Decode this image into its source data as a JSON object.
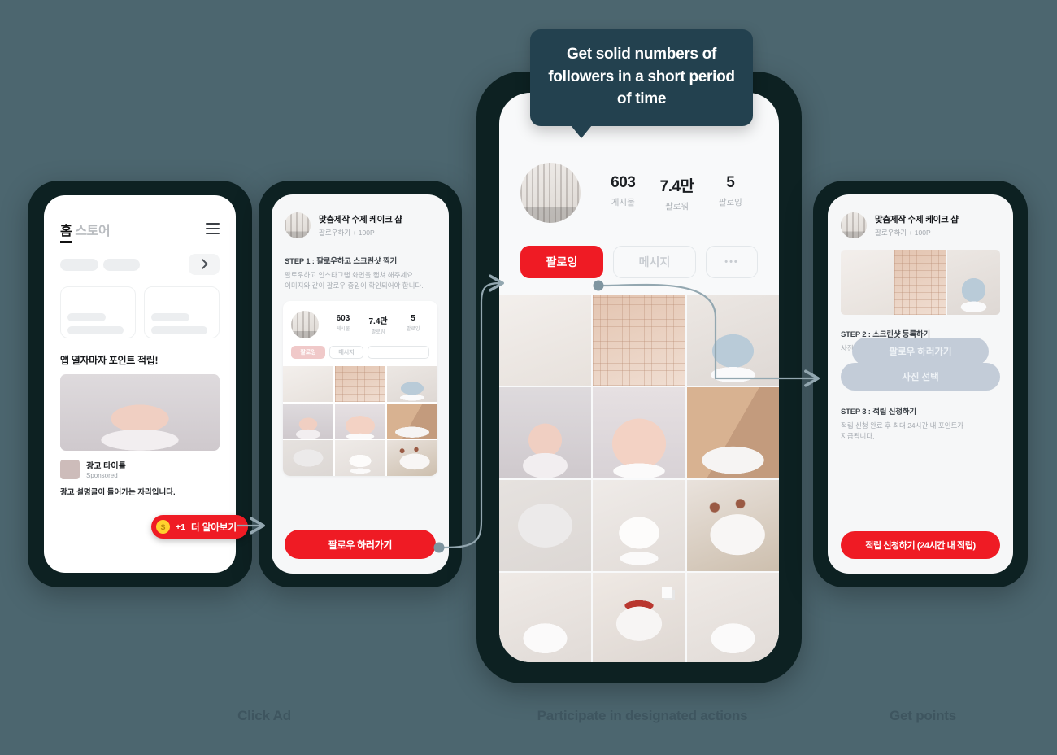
{
  "background_color": "#4c666f",
  "frame_color": "#0d2122",
  "accent_red": "#ef1b24",
  "tooltip": {
    "text": "Get solid numbers of followers in a short period of time",
    "bg": "#23414f"
  },
  "phone1": {
    "tab_active": "홈",
    "tab_inactive": "스토어",
    "menu_icon": "hamburger-icon",
    "ad_heading": "앱 열자마자 포인트 적립!",
    "ad_title": "광고 타이틀",
    "ad_sponsored": "Sponsored",
    "ad_description": "광고 설명글이 들어가는 자리입니다.",
    "cta": {
      "coin": "S",
      "points": "+1",
      "label": "더 알아보기"
    }
  },
  "phone2": {
    "shop_name": "맞춤제작 수제 케이크 샵",
    "shop_sub": "팔로우하기 + 100P",
    "step_title": "STEP 1 : 팔로우하고 스크린샷 찍기",
    "step_desc_1": "팔로우하고  인스타그램 화면을 캡쳐 해주세요.",
    "step_desc_2": "이미지와 같이 팔로우 중임이 확인되어야 합니다.",
    "mock": {
      "stats": [
        {
          "value": "603",
          "label": "게시물"
        },
        {
          "value": "7.4만",
          "label": "팔로워"
        },
        {
          "value": "5",
          "label": "팔로잉"
        }
      ],
      "btn_follow": "팔로잉",
      "btn_message": "메시지",
      "btn_more": ""
    },
    "cta_button": "팔로우 하러가기"
  },
  "phone3": {
    "stats": [
      {
        "value": "603",
        "label": "게시물"
      },
      {
        "value": "7.4만",
        "label": "팔로워"
      },
      {
        "value": "5",
        "label": "팔로잉"
      }
    ],
    "btn_follow": "팔로잉",
    "btn_message": "메시지",
    "btn_more": "•••",
    "grid_cells": [
      "wall-curtain-photo",
      "tiled-kitchen-sink-photo",
      "blue-cake-with-topper-photo",
      "pink-frosted-cake-closeup-photo",
      "small-pink-cake-on-stand-photo",
      "layered-cake-slice-photo",
      "decorated-plate-photo",
      "white-cake-with-candle-photo",
      "rose-decorated-cake-photo",
      "white-cake-dried-flowers-photo",
      "strawberry-topped-cake-photo",
      "white-cake-red-topper-photo"
    ]
  },
  "phone4": {
    "shop_name": "맞춤제작 수제 케이크 샵",
    "shop_sub": "팔로우하기 + 100P",
    "btn_follow_go": "팔로우 하러가기",
    "step2_title": "STEP 2 : 스크린샷 등록하기",
    "step2_desc": "사진 선택을 눌러 스크린샷을 등록해주세요.",
    "btn_pick_photo": "사진 선택",
    "step3_title": "STEP 3 : 적립 신청하기",
    "step3_desc_1": "적립 신청 완료 후 최대 24시간 내 포인트가",
    "step3_desc_2": "지급됩니다.",
    "btn_submit": "적립 신청하기 (24시간 내 적립)"
  },
  "captions": {
    "step1": "Click Ad",
    "step2": "Participate in designated actions",
    "step3": "Get points"
  }
}
